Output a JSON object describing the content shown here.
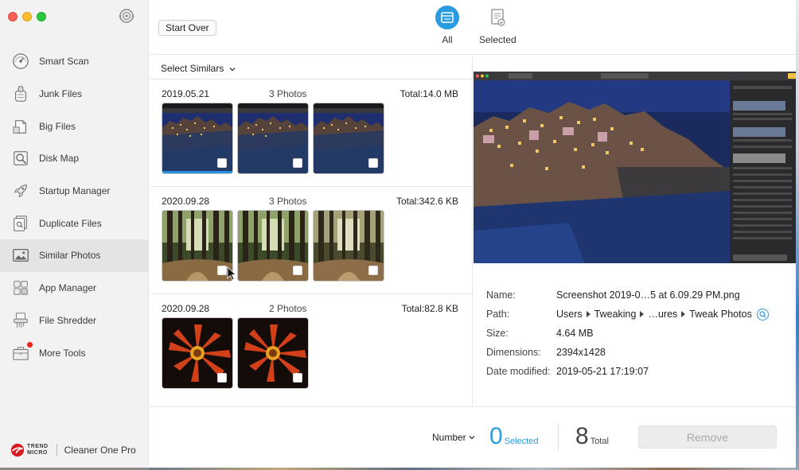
{
  "app": {
    "brand_company_line1": "TREND",
    "brand_company_line2": "MICRO",
    "brand_name": "Cleaner One Pro"
  },
  "sidebar": {
    "items": [
      {
        "label": "Smart Scan",
        "icon": "gauge-icon"
      },
      {
        "label": "Junk Files",
        "icon": "vacuum-icon"
      },
      {
        "label": "Big Files",
        "icon": "big-file-icon"
      },
      {
        "label": "Disk Map",
        "icon": "disk-map-icon"
      },
      {
        "label": "Startup Manager",
        "icon": "rocket-icon"
      },
      {
        "label": "Duplicate Files",
        "icon": "duplicate-file-icon"
      },
      {
        "label": "Similar Photos",
        "icon": "photo-icon"
      },
      {
        "label": "App Manager",
        "icon": "apps-grid-icon"
      },
      {
        "label": "File Shredder",
        "icon": "shredder-icon"
      },
      {
        "label": "More Tools",
        "icon": "toolbox-icon"
      }
    ],
    "active_index": 6
  },
  "toolbar": {
    "start_over_label": "Start Over",
    "tab_all_label": "All",
    "tab_selected_label": "Selected"
  },
  "list": {
    "select_similars_label": "Select Similars",
    "groups": [
      {
        "date": "2019.05.21",
        "count": "3 Photos",
        "total": "Total:14.0 MB",
        "kind": "cityscape",
        "photos": 3
      },
      {
        "date": "2020.09.28",
        "count": "3 Photos",
        "total": "Total:342.6 KB",
        "kind": "forest",
        "photos": 3
      },
      {
        "date": "2020.09.28",
        "count": "2 Photos",
        "total": "Total:82.8 KB",
        "kind": "flower",
        "photos": 2
      }
    ]
  },
  "details": {
    "name_key": "Name:",
    "name_val": "Screenshot 2019-0…5 at 6.09.29 PM.png",
    "path_key": "Path:",
    "path_parts": [
      "Users",
      "Tweaking",
      "…ures",
      "Tweak Photos"
    ],
    "size_key": "Size:",
    "size_val": "4.64 MB",
    "dim_key": "Dimensions:",
    "dim_val": "2394x1428",
    "date_key": "Date modified:",
    "date_val": "2019-05-21 17:19:07"
  },
  "bottom": {
    "sort_label": "Number",
    "selected_count": "0",
    "selected_caption": "Selected",
    "total_count": "8",
    "total_caption": "Total",
    "remove_label": "Remove"
  },
  "colors": {
    "accent": "#2a9be0",
    "active_nav": "#e4e4e4"
  }
}
